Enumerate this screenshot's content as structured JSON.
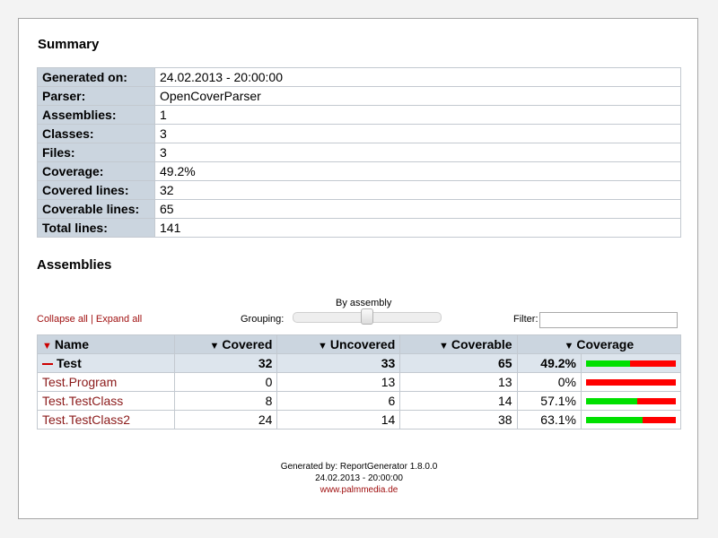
{
  "summary": {
    "title": "Summary",
    "rows": [
      {
        "label": "Generated on:",
        "value": "24.02.2013 - 20:00:00"
      },
      {
        "label": "Parser:",
        "value": "OpenCoverParser"
      },
      {
        "label": "Assemblies:",
        "value": "1"
      },
      {
        "label": "Classes:",
        "value": "3"
      },
      {
        "label": "Files:",
        "value": "3"
      },
      {
        "label": "Coverage:",
        "value": "49.2%"
      },
      {
        "label": "Covered lines:",
        "value": "32"
      },
      {
        "label": "Coverable lines:",
        "value": "65"
      },
      {
        "label": "Total lines:",
        "value": "141"
      }
    ]
  },
  "assemblies": {
    "title": "Assemblies",
    "collapse_all": "Collapse all",
    "separator": "|",
    "expand_all": "Expand all",
    "grouping_title": "By assembly",
    "grouping_label": "Grouping:",
    "filter_label": "Filter:",
    "filter_value": "",
    "columns": {
      "name": "Name",
      "covered": "Covered",
      "uncovered": "Uncovered",
      "coverable": "Coverable",
      "coverage": "Coverage"
    },
    "assembly_row": {
      "name": "Test",
      "covered": "32",
      "uncovered": "33",
      "coverable": "65",
      "coverage": "49.2%",
      "coverage_fraction": 0.492
    },
    "classes": [
      {
        "name": "Test.Program",
        "covered": "0",
        "uncovered": "13",
        "coverable": "13",
        "coverage": "0%",
        "coverage_fraction": 0.0
      },
      {
        "name": "Test.TestClass",
        "covered": "8",
        "uncovered": "6",
        "coverable": "14",
        "coverage": "57.1%",
        "coverage_fraction": 0.571
      },
      {
        "name": "Test.TestClass2",
        "covered": "24",
        "uncovered": "14",
        "coverable": "38",
        "coverage": "63.1%",
        "coverage_fraction": 0.631
      }
    ]
  },
  "colors": {
    "covered_bar": "#00e000",
    "uncovered_bar": "#ff0000",
    "link": "#a01010",
    "header_bg": "#cbd5df"
  },
  "footer": {
    "generated_by": "Generated by: ReportGenerator 1.8.0.0",
    "date": "24.02.2013 - 20:00:00",
    "link": "www.palmmedia.de"
  }
}
